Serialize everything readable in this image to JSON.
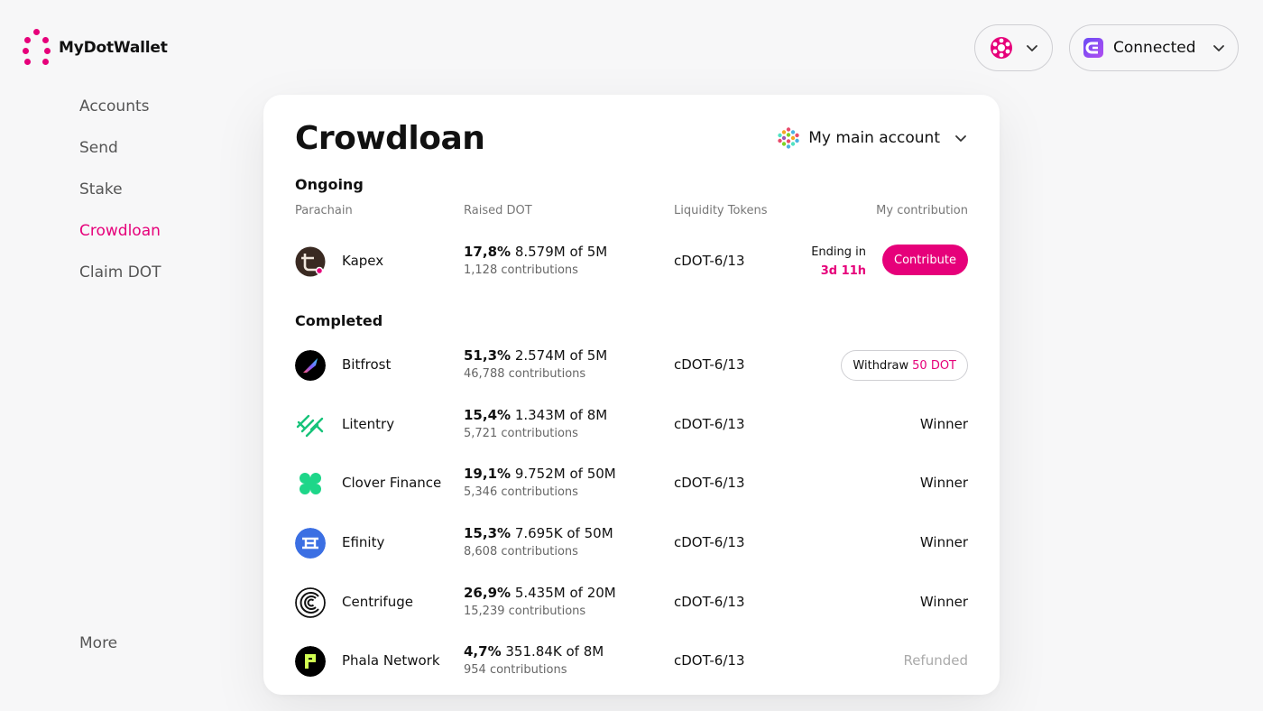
{
  "app": {
    "name": "MyDotWallet"
  },
  "header": {
    "network_icon": "polkadot-icon",
    "connect_label": "Connected",
    "connect_icon": "wallet-extension-icon"
  },
  "sidebar": {
    "items": [
      {
        "label": "Accounts",
        "active": false
      },
      {
        "label": "Send",
        "active": false
      },
      {
        "label": "Stake",
        "active": false
      },
      {
        "label": "Crowdloan",
        "active": true
      },
      {
        "label": "Claim DOT",
        "active": false
      }
    ],
    "more_label": "More"
  },
  "card": {
    "title": "Crowdloan",
    "account_label": "My main account",
    "ongoing_heading": "Ongoing",
    "completed_heading": "Completed",
    "columns": {
      "parachain": "Parachain",
      "raised": "Raised DOT",
      "tokens": "Liquidity Tokens",
      "contribution": "My contribution"
    }
  },
  "ongoing": [
    {
      "name": "Kapex",
      "percent": "17,8%",
      "amount": "8.579M of 5M",
      "contributions": "1,128 contributions",
      "token": "cDOT-6/13",
      "ending_label": "Ending in",
      "ending_time": "3d 11h",
      "action_label": "Contribute",
      "color": "#3a2a22"
    }
  ],
  "completed": [
    {
      "name": "Bitfrost",
      "percent": "51,3%",
      "amount": "2.574M of 5M",
      "contributions": "46,788 contributions",
      "token": "cDOT-6/13",
      "withdraw_label": "Withdraw",
      "withdraw_amount": "50 DOT",
      "color": "#000000"
    },
    {
      "name": "Litentry",
      "percent": "15,4%",
      "amount": "1.343M of 8M",
      "contributions": "5,721 contributions",
      "token": "cDOT-6/13",
      "status": "Winner",
      "color": "#17c37a"
    },
    {
      "name": "Clover Finance",
      "percent": "19,1%",
      "amount": "9.752M of 50M",
      "contributions": "5,346 contributions",
      "token": "cDOT-6/13",
      "status": "Winner",
      "color": "#1ed689"
    },
    {
      "name": "Efinity",
      "percent": "15,3%",
      "amount": "7.695K of 50M",
      "contributions": "8,608 contributions",
      "token": "cDOT-6/13",
      "status": "Winner",
      "color": "#3b6fe3"
    },
    {
      "name": "Centrifuge",
      "percent": "26,9%",
      "amount": "5.435M of 20M",
      "contributions": "15,239 contributions",
      "token": "cDOT-6/13",
      "status": "Winner",
      "color": "#111111"
    },
    {
      "name": "Phala Network",
      "percent": "4,7%",
      "amount": "351.84K of 8M",
      "contributions": "954 contributions",
      "token": "cDOT-6/13",
      "status": "Refunded",
      "color": "#000000"
    }
  ],
  "colors": {
    "accent": "#e6007a",
    "background": "#f7f7f8"
  }
}
